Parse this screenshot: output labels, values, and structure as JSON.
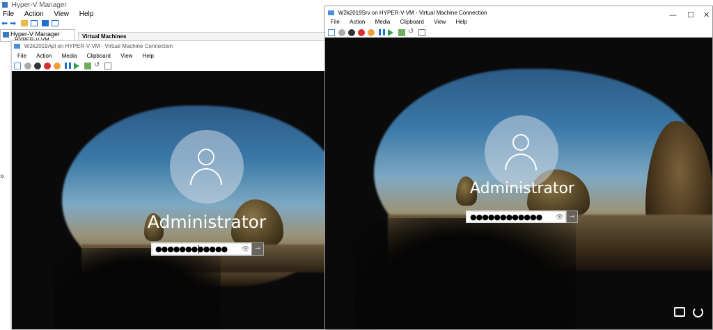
{
  "manager": {
    "title": "Hyper-V Manager",
    "menu": [
      "File",
      "Action",
      "View",
      "Help"
    ],
    "tree_root": "Hyper-V Manager",
    "tree_child": "HYPER-V-VM",
    "panel_header": "Virtual Machines",
    "expand_glyph": "»"
  },
  "vm_left": {
    "title": "W2k2019Apl on HYPER-V-VM - Virtual Machine Connection",
    "menu": [
      "File",
      "Action",
      "Media",
      "Clipboard",
      "View",
      "Help"
    ],
    "username": "Administrator",
    "password_mask": "●●●●●●●●●●●●",
    "submit_glyph": "→",
    "reveal_glyph": "👁"
  },
  "vm_right": {
    "title": "W2k2019Srv on HYPER-V-VM - Virtual Machine Connection",
    "menu": [
      "File",
      "Action",
      "Media",
      "Clipboard",
      "View",
      "Help"
    ],
    "controls": {
      "minimize": "—",
      "maximize": "☐",
      "close": "✕"
    },
    "username": "Administrator",
    "password_mask": "●●●●●●●●●●●●",
    "submit_glyph": "→",
    "reveal_glyph": "👁"
  },
  "colors": {
    "stop_red": "#d32f2f",
    "shutdown_orange": "#f29d38",
    "start_green": "#2ea44f",
    "pause_blue": "#1f6fd1"
  }
}
